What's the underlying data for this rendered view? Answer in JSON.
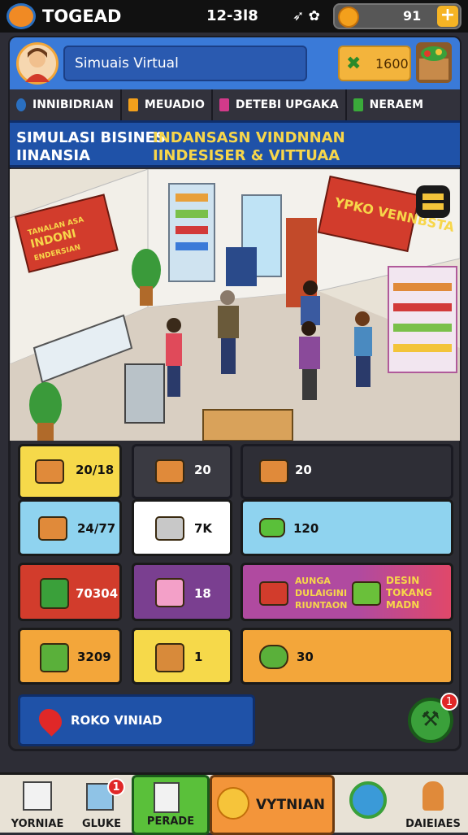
{
  "status_bar": {
    "app_name": "TOGEAD",
    "time": "12-3l8",
    "coins": "91",
    "plus": "+"
  },
  "header": {
    "player_name": "Simuais Virtual",
    "cash": "1600"
  },
  "tabs": [
    {
      "label": "INNIBIDRIAN",
      "color": "#2a6fc0"
    },
    {
      "label": "MEUADIO",
      "color": "#f3a01c"
    },
    {
      "label": "DETEBI UPGAKA",
      "color": "#d23a8a"
    },
    {
      "label": "NERAEM",
      "color": "#3aaa3a"
    }
  ],
  "banner": {
    "left_line1": "SIMULASI BISINES",
    "left_line2": "IINANSIA",
    "right_line1": "INDANSASN VINDNNAN",
    "right_line2": "IINDESISER & VITTUAA"
  },
  "scene": {
    "store_sign": "YPKO VENNBSTA",
    "left_sign_line1": "TANALAN ASA",
    "left_sign_line2": "INDONI",
    "left_sign_line3": "ENDERSIAN"
  },
  "tiles": [
    {
      "value": "20/18",
      "bg": "#f6d94a"
    },
    {
      "value": "20",
      "bg": "#3a3a42"
    },
    {
      "value": "20",
      "bg": "#2e2e36"
    },
    {
      "value": "24/77",
      "bg": "#8fd3ef"
    },
    {
      "value": "7K",
      "bg": "#ffffff"
    },
    {
      "value": "120",
      "bg": "#8fd3ef"
    },
    {
      "value": "70304",
      "bg": "#d23c2c"
    },
    {
      "value": "18",
      "bg": "#7a3f90"
    },
    {
      "value": "AUNGA DULAIGINI RIUNTAON",
      "value2": "DESIN TOKANG MADN",
      "bg": "#b04aa0"
    },
    {
      "value": "3209",
      "bg": "#f3a63a"
    },
    {
      "value": "1",
      "bg": "#f6d94a"
    },
    {
      "value": "30",
      "bg": "#f3a63a"
    }
  ],
  "location_button": {
    "label": "ROKO VINIAD"
  },
  "fab": {
    "badge": "1"
  },
  "bottom_nav": [
    {
      "label": "YORNIAE"
    },
    {
      "label": "GLUKE",
      "badge": "1"
    },
    {
      "label": "PERADE"
    },
    {
      "label": "VYTNIAN"
    },
    {
      "label": ""
    },
    {
      "label": "DAIEIAES"
    }
  ]
}
